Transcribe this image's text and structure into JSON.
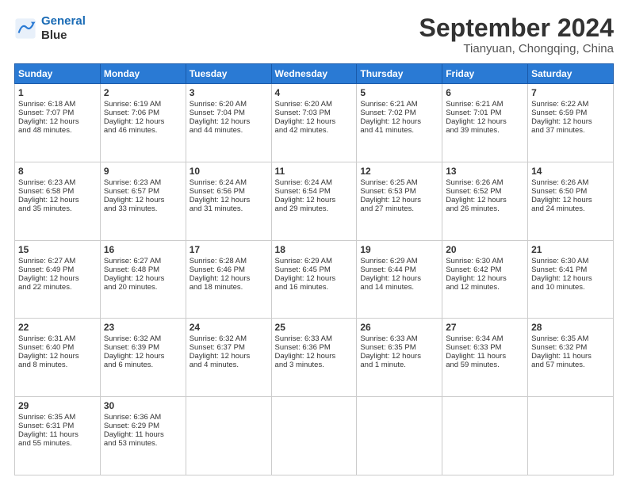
{
  "logo": {
    "line1": "General",
    "line2": "Blue"
  },
  "title": "September 2024",
  "location": "Tianyuan, Chongqing, China",
  "headers": [
    "Sunday",
    "Monday",
    "Tuesday",
    "Wednesday",
    "Thursday",
    "Friday",
    "Saturday"
  ],
  "weeks": [
    [
      {
        "day": "1",
        "lines": [
          "Sunrise: 6:18 AM",
          "Sunset: 7:07 PM",
          "Daylight: 12 hours",
          "and 48 minutes."
        ]
      },
      {
        "day": "2",
        "lines": [
          "Sunrise: 6:19 AM",
          "Sunset: 7:06 PM",
          "Daylight: 12 hours",
          "and 46 minutes."
        ]
      },
      {
        "day": "3",
        "lines": [
          "Sunrise: 6:20 AM",
          "Sunset: 7:04 PM",
          "Daylight: 12 hours",
          "and 44 minutes."
        ]
      },
      {
        "day": "4",
        "lines": [
          "Sunrise: 6:20 AM",
          "Sunset: 7:03 PM",
          "Daylight: 12 hours",
          "and 42 minutes."
        ]
      },
      {
        "day": "5",
        "lines": [
          "Sunrise: 6:21 AM",
          "Sunset: 7:02 PM",
          "Daylight: 12 hours",
          "and 41 minutes."
        ]
      },
      {
        "day": "6",
        "lines": [
          "Sunrise: 6:21 AM",
          "Sunset: 7:01 PM",
          "Daylight: 12 hours",
          "and 39 minutes."
        ]
      },
      {
        "day": "7",
        "lines": [
          "Sunrise: 6:22 AM",
          "Sunset: 6:59 PM",
          "Daylight: 12 hours",
          "and 37 minutes."
        ]
      }
    ],
    [
      {
        "day": "8",
        "lines": [
          "Sunrise: 6:23 AM",
          "Sunset: 6:58 PM",
          "Daylight: 12 hours",
          "and 35 minutes."
        ]
      },
      {
        "day": "9",
        "lines": [
          "Sunrise: 6:23 AM",
          "Sunset: 6:57 PM",
          "Daylight: 12 hours",
          "and 33 minutes."
        ]
      },
      {
        "day": "10",
        "lines": [
          "Sunrise: 6:24 AM",
          "Sunset: 6:56 PM",
          "Daylight: 12 hours",
          "and 31 minutes."
        ]
      },
      {
        "day": "11",
        "lines": [
          "Sunrise: 6:24 AM",
          "Sunset: 6:54 PM",
          "Daylight: 12 hours",
          "and 29 minutes."
        ]
      },
      {
        "day": "12",
        "lines": [
          "Sunrise: 6:25 AM",
          "Sunset: 6:53 PM",
          "Daylight: 12 hours",
          "and 27 minutes."
        ]
      },
      {
        "day": "13",
        "lines": [
          "Sunrise: 6:26 AM",
          "Sunset: 6:52 PM",
          "Daylight: 12 hours",
          "and 26 minutes."
        ]
      },
      {
        "day": "14",
        "lines": [
          "Sunrise: 6:26 AM",
          "Sunset: 6:50 PM",
          "Daylight: 12 hours",
          "and 24 minutes."
        ]
      }
    ],
    [
      {
        "day": "15",
        "lines": [
          "Sunrise: 6:27 AM",
          "Sunset: 6:49 PM",
          "Daylight: 12 hours",
          "and 22 minutes."
        ]
      },
      {
        "day": "16",
        "lines": [
          "Sunrise: 6:27 AM",
          "Sunset: 6:48 PM",
          "Daylight: 12 hours",
          "and 20 minutes."
        ]
      },
      {
        "day": "17",
        "lines": [
          "Sunrise: 6:28 AM",
          "Sunset: 6:46 PM",
          "Daylight: 12 hours",
          "and 18 minutes."
        ]
      },
      {
        "day": "18",
        "lines": [
          "Sunrise: 6:29 AM",
          "Sunset: 6:45 PM",
          "Daylight: 12 hours",
          "and 16 minutes."
        ]
      },
      {
        "day": "19",
        "lines": [
          "Sunrise: 6:29 AM",
          "Sunset: 6:44 PM",
          "Daylight: 12 hours",
          "and 14 minutes."
        ]
      },
      {
        "day": "20",
        "lines": [
          "Sunrise: 6:30 AM",
          "Sunset: 6:42 PM",
          "Daylight: 12 hours",
          "and 12 minutes."
        ]
      },
      {
        "day": "21",
        "lines": [
          "Sunrise: 6:30 AM",
          "Sunset: 6:41 PM",
          "Daylight: 12 hours",
          "and 10 minutes."
        ]
      }
    ],
    [
      {
        "day": "22",
        "lines": [
          "Sunrise: 6:31 AM",
          "Sunset: 6:40 PM",
          "Daylight: 12 hours",
          "and 8 minutes."
        ]
      },
      {
        "day": "23",
        "lines": [
          "Sunrise: 6:32 AM",
          "Sunset: 6:39 PM",
          "Daylight: 12 hours",
          "and 6 minutes."
        ]
      },
      {
        "day": "24",
        "lines": [
          "Sunrise: 6:32 AM",
          "Sunset: 6:37 PM",
          "Daylight: 12 hours",
          "and 4 minutes."
        ]
      },
      {
        "day": "25",
        "lines": [
          "Sunrise: 6:33 AM",
          "Sunset: 6:36 PM",
          "Daylight: 12 hours",
          "and 3 minutes."
        ]
      },
      {
        "day": "26",
        "lines": [
          "Sunrise: 6:33 AM",
          "Sunset: 6:35 PM",
          "Daylight: 12 hours",
          "and 1 minute."
        ]
      },
      {
        "day": "27",
        "lines": [
          "Sunrise: 6:34 AM",
          "Sunset: 6:33 PM",
          "Daylight: 11 hours",
          "and 59 minutes."
        ]
      },
      {
        "day": "28",
        "lines": [
          "Sunrise: 6:35 AM",
          "Sunset: 6:32 PM",
          "Daylight: 11 hours",
          "and 57 minutes."
        ]
      }
    ],
    [
      {
        "day": "29",
        "lines": [
          "Sunrise: 6:35 AM",
          "Sunset: 6:31 PM",
          "Daylight: 11 hours",
          "and 55 minutes."
        ]
      },
      {
        "day": "30",
        "lines": [
          "Sunrise: 6:36 AM",
          "Sunset: 6:29 PM",
          "Daylight: 11 hours",
          "and 53 minutes."
        ]
      },
      {
        "day": "",
        "lines": []
      },
      {
        "day": "",
        "lines": []
      },
      {
        "day": "",
        "lines": []
      },
      {
        "day": "",
        "lines": []
      },
      {
        "day": "",
        "lines": []
      }
    ]
  ]
}
